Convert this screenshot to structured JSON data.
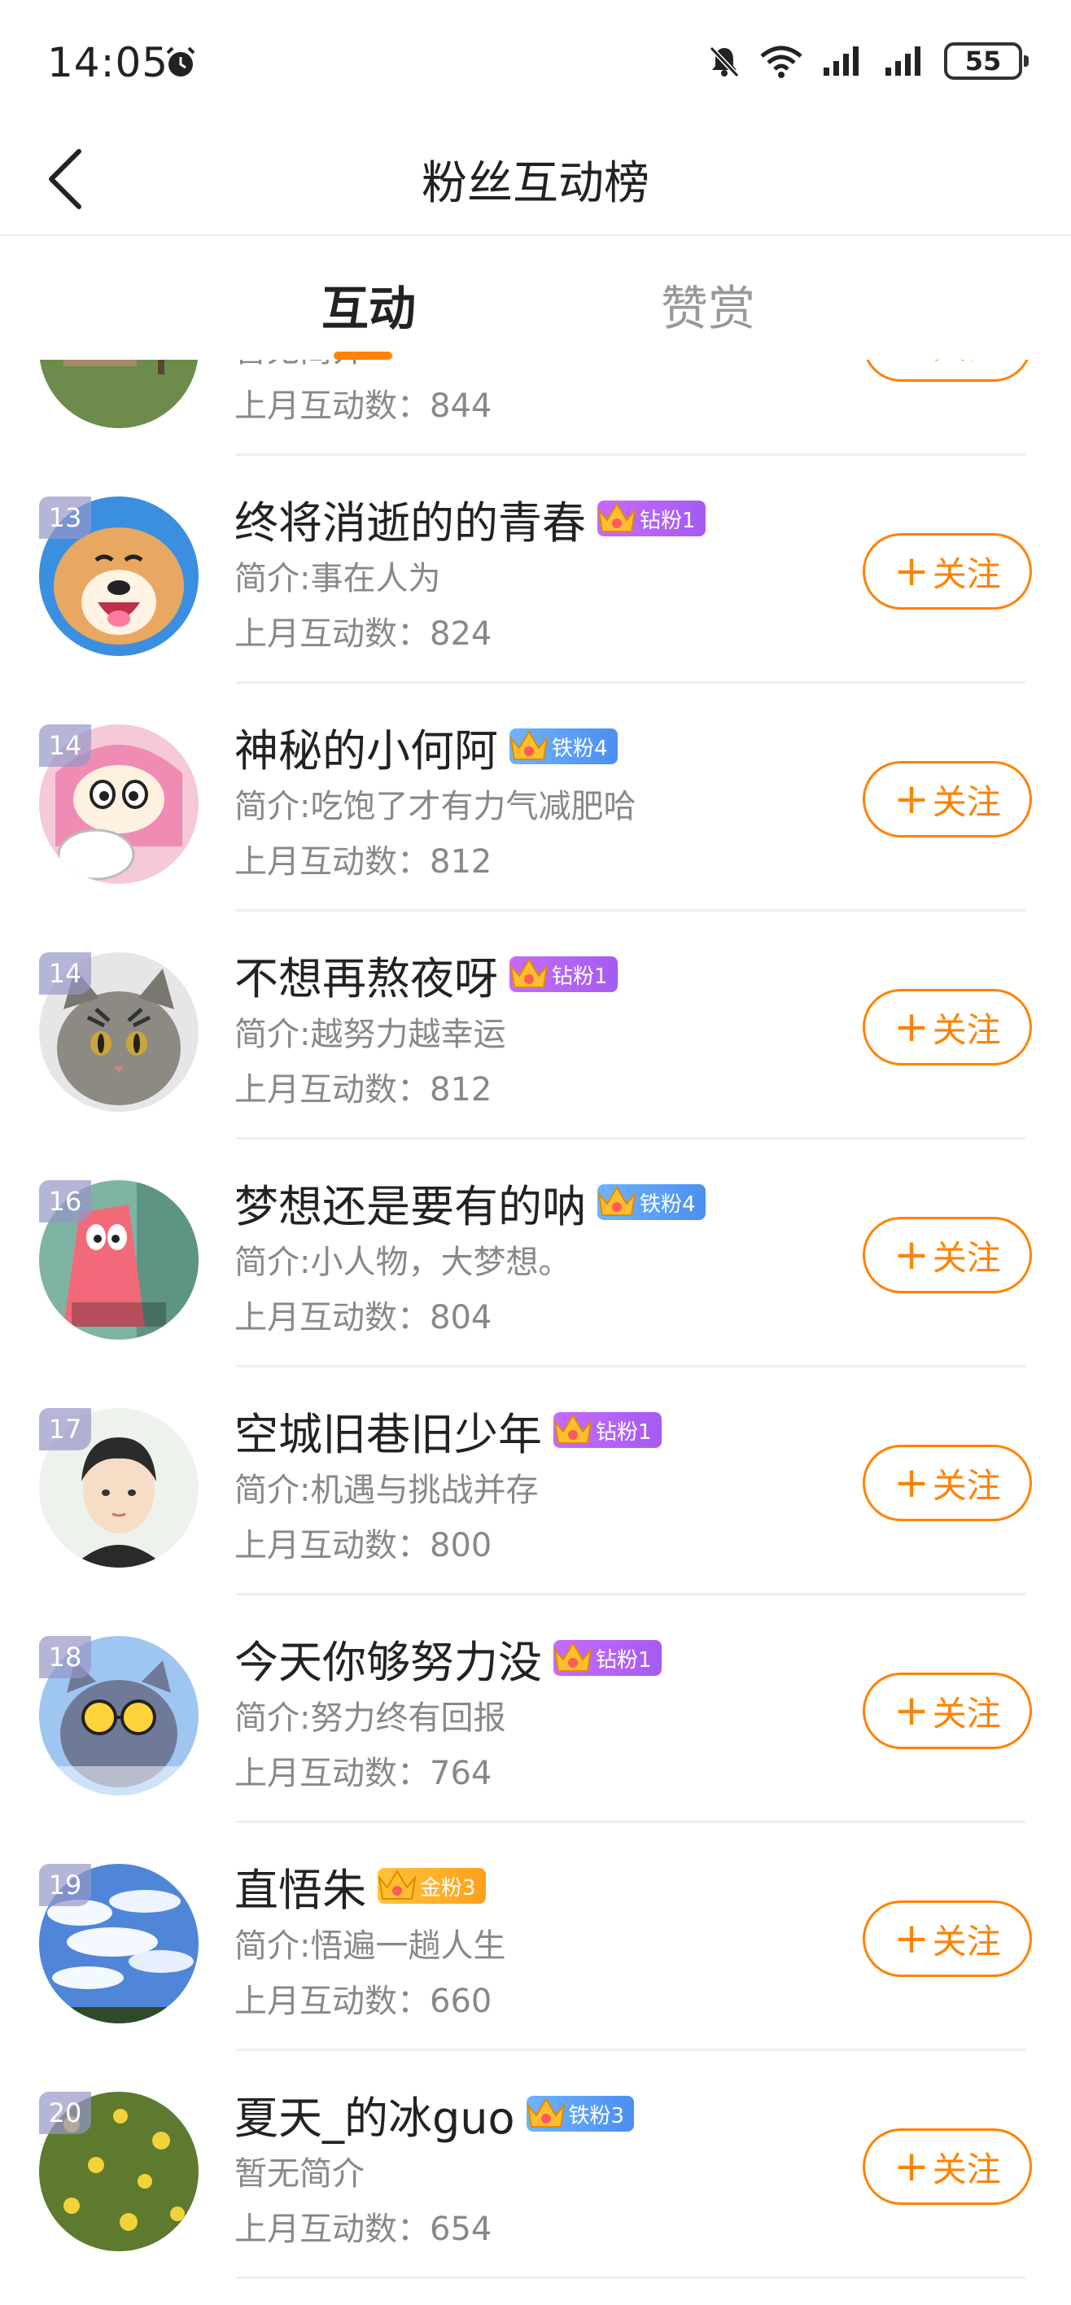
{
  "status_bar": {
    "time": "14:05",
    "battery": "55"
  },
  "nav": {
    "title": "粉丝互动榜"
  },
  "tabs": [
    {
      "label": "互动"
    },
    {
      "label": "赞赏"
    }
  ],
  "list": {
    "follow_label": "关注",
    "rows": [
      {
        "rank": "",
        "name": "",
        "badge": "",
        "badge_type": "none",
        "intro": "暂无简介",
        "count_label": "上月互动数：",
        "count": "844"
      },
      {
        "rank": "13",
        "name": "终将消逝的的青春",
        "badge": "钻粉1",
        "badge_type": "diamond",
        "intro": "简介:事在人为",
        "count_label": "上月互动数：",
        "count": "824"
      },
      {
        "rank": "14",
        "name": "神秘的小何阿",
        "badge": "铁粉4",
        "badge_type": "iron",
        "intro": "简介:吃饱了才有力气减肥哈",
        "count_label": "上月互动数：",
        "count": "812"
      },
      {
        "rank": "14",
        "name": "不想再熬夜呀",
        "badge": "钻粉1",
        "badge_type": "diamond",
        "intro": "简介:越努力越幸运",
        "count_label": "上月互动数：",
        "count": "812"
      },
      {
        "rank": "16",
        "name": "梦想还是要有的呐",
        "badge": "铁粉4",
        "badge_type": "iron",
        "intro": "简介:小人物，大梦想。",
        "count_label": "上月互动数：",
        "count": "804"
      },
      {
        "rank": "17",
        "name": "空城旧巷旧少年",
        "badge": "钻粉1",
        "badge_type": "diamond",
        "intro": "简介:机遇与挑战并存",
        "count_label": "上月互动数：",
        "count": "800"
      },
      {
        "rank": "18",
        "name": "今天你够努力没",
        "badge": "钻粉1",
        "badge_type": "diamond",
        "intro": "简介:努力终有回报",
        "count_label": "上月互动数：",
        "count": "764"
      },
      {
        "rank": "19",
        "name": "直悟朱",
        "badge": "金粉3",
        "badge_type": "gold",
        "intro": "简介:悟遍一趟人生",
        "count_label": "上月互动数：",
        "count": "660"
      },
      {
        "rank": "20",
        "name": "夏天_的冰guo",
        "badge": "铁粉3",
        "badge_type": "iron",
        "intro": "暂无简介",
        "count_label": "上月互动数：",
        "count": "654"
      }
    ]
  },
  "colors": {
    "accent": "#ff8200",
    "text_primary": "#222222",
    "text_secondary": "#888888",
    "diamond": "#b065f5",
    "iron": "#5a9ef5",
    "gold": "#ffb02e"
  }
}
